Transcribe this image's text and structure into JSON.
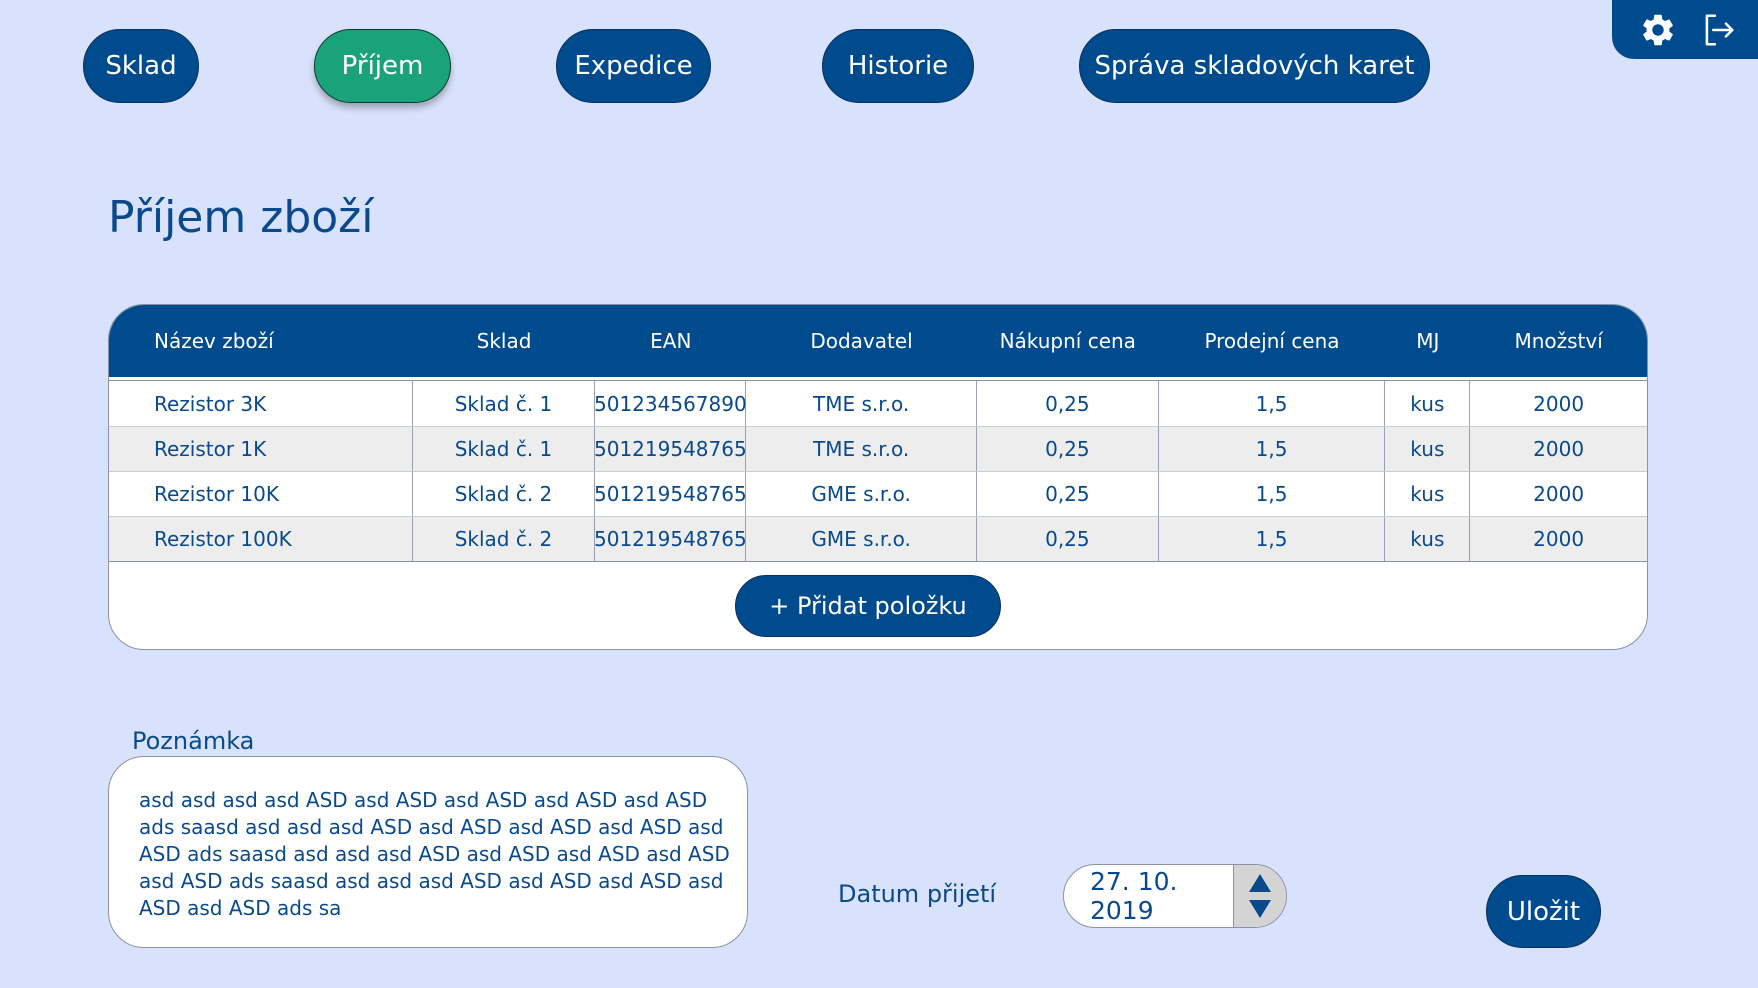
{
  "nav": {
    "sklad": "Sklad",
    "prijem": "Příjem",
    "expedice": "Expedice",
    "historie": "Historie",
    "sprava": "Správa skladových karet"
  },
  "icons": {
    "settings": "gear-icon",
    "logout": "logout-icon"
  },
  "page": {
    "title": "Příjem zboží"
  },
  "table": {
    "headers": [
      "Název zboží",
      "Sklad",
      "EAN",
      "Dodavatel",
      "Nákupní cena",
      "Prodejní cena",
      "MJ",
      "Množství"
    ],
    "rows": [
      [
        "Rezistor 3K",
        "Sklad č. 1",
        "501234567890",
        "TME s.r.o.",
        "0,25",
        "1,5",
        "kus",
        "2000"
      ],
      [
        "Rezistor 1K",
        "Sklad č. 1",
        "501219548765",
        "TME s.r.o.",
        "0,25",
        "1,5",
        "kus",
        "2000"
      ],
      [
        "Rezistor 10K",
        "Sklad č. 2",
        "501219548765",
        "GME s.r.o.",
        "0,25",
        "1,5",
        "kus",
        "2000"
      ],
      [
        "Rezistor 100K",
        "Sklad č. 2",
        "501219548765",
        "GME s.r.o.",
        "0,25",
        "1,5",
        "kus",
        "2000"
      ]
    ],
    "add_label": "+ Přidat položku"
  },
  "note": {
    "label": "Poznámka",
    "text": "asd asd asd asd ASD asd ASD asd ASD asd ASD asd ASD ads saasd asd asd asd ASD asd ASD asd ASD asd ASD asd ASD ads saasd asd asd asd ASD asd ASD asd ASD asd ASD asd ASD ads saasd asd asd asd ASD asd ASD asd ASD asd ASD asd ASD ads sa"
  },
  "date": {
    "label": "Datum přijetí",
    "value": "27. 10. 2019"
  },
  "save_label": "Uložit",
  "colors": {
    "background": "#d8e2fc",
    "primary": "#004b8d",
    "active": "#1aa37a",
    "text": "#0a4a8c"
  }
}
